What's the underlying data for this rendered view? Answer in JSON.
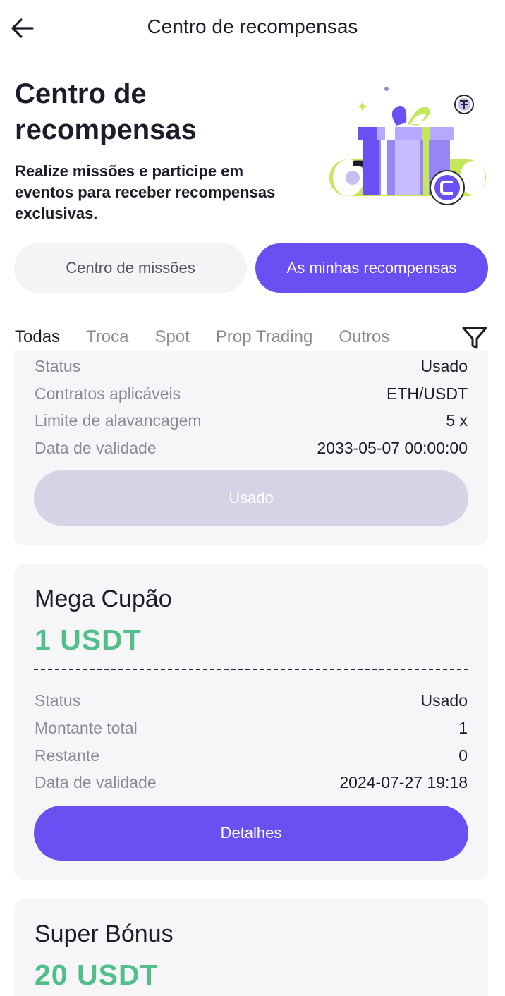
{
  "header": {
    "title": "Centro de recompensas"
  },
  "hero": {
    "title": "Centro de recompensas",
    "subtitle": "Realize missões e participe em eventos para receber recompensas exclusivas."
  },
  "segments": {
    "missions": "Centro de missões",
    "rewards": "As minhas recompensas",
    "selected": "rewards"
  },
  "tabs": [
    {
      "label": "Todas",
      "active": true
    },
    {
      "label": "Troca",
      "active": false
    },
    {
      "label": "Spot",
      "active": false
    },
    {
      "label": "Prop Trading",
      "active": false
    },
    {
      "label": "Outros",
      "active": false
    }
  ],
  "cards": [
    {
      "rows": [
        {
          "label": "Status",
          "value": "Usado"
        },
        {
          "label": "Contratos aplicáveis",
          "value": "ETH/USDT"
        },
        {
          "label": "Limite de alavancagem",
          "value": "5 x"
        },
        {
          "label": "Data de validade",
          "value": "2033-05-07 00:00:00"
        }
      ],
      "button": "Usado"
    },
    {
      "title": "Mega Cupão",
      "amount": "1 USDT",
      "rows": [
        {
          "label": "Status",
          "value": "Usado"
        },
        {
          "label": "Montante total",
          "value": "1"
        },
        {
          "label": "Restante",
          "value": "0"
        },
        {
          "label": "Data de validade",
          "value": "2024-07-27 19:18"
        }
      ],
      "button": "Detalhes"
    },
    {
      "title": "Super Bónus",
      "amount": "20 USDT"
    }
  ],
  "icons": {
    "back": "arrow-left-icon",
    "filter": "filter-funnel-icon",
    "illustration": "gift-box-illustration"
  },
  "colors": {
    "accent": "#6a4ff2",
    "amount": "#52be8a",
    "used_button": "#d6d3e6",
    "card_bg": "#f6f6f9"
  }
}
